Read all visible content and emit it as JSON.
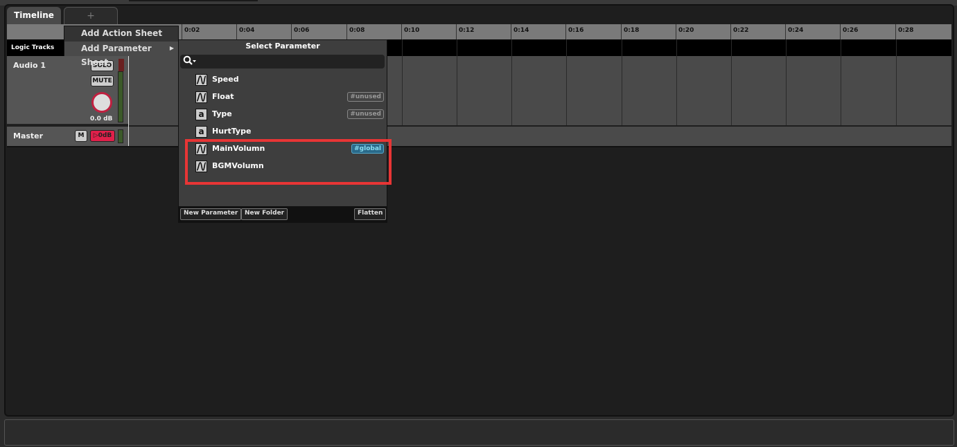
{
  "tabs": [
    {
      "label": "Timeline",
      "active": true
    },
    {
      "label": "+"
    }
  ],
  "ruler": {
    "ticks": [
      "0:02",
      "0:04",
      "0:06",
      "0:08",
      "0:10",
      "0:12",
      "0:14",
      "0:16",
      "0:18",
      "0:20",
      "0:22",
      "0:24",
      "0:26",
      "0:28"
    ]
  },
  "logic_tracks_label": "Logic Tracks",
  "tracks": {
    "audio1": {
      "name": "Audio 1",
      "solo_label": "SOLO",
      "mute_label": "MUTE",
      "volume": "0.0 dB"
    },
    "master": {
      "name": "Master",
      "m_label": "M",
      "level_label": "0dB"
    }
  },
  "context_menu": {
    "items": [
      {
        "label": "Add Action Sheet"
      },
      {
        "label": "Add Parameter Sheet",
        "has_submenu": true
      }
    ]
  },
  "select_parameter": {
    "title": "Select Parameter",
    "search_value": "",
    "parameters": [
      {
        "name": "Speed",
        "icon": "curve-icon",
        "tag": ""
      },
      {
        "name": "Float",
        "icon": "curve-icon",
        "tag": "#unused"
      },
      {
        "name": "Type",
        "icon": "text-icon",
        "icon_glyph": "a",
        "tag": "#unused"
      },
      {
        "name": "HurtType",
        "icon": "text-icon",
        "icon_glyph": "a",
        "tag": ""
      },
      {
        "name": "MainVolumn",
        "icon": "curve-icon",
        "tag": "#global"
      },
      {
        "name": "BGMVolumn",
        "icon": "curve-icon",
        "tag": ""
      }
    ],
    "footer": {
      "new_parameter": "New Parameter",
      "new_folder": "New Folder",
      "flatten": "Flatten"
    }
  },
  "colors": {
    "highlight": "#e83535",
    "global_tag": "#2a6a8a",
    "knob_ring": "#c02040"
  }
}
